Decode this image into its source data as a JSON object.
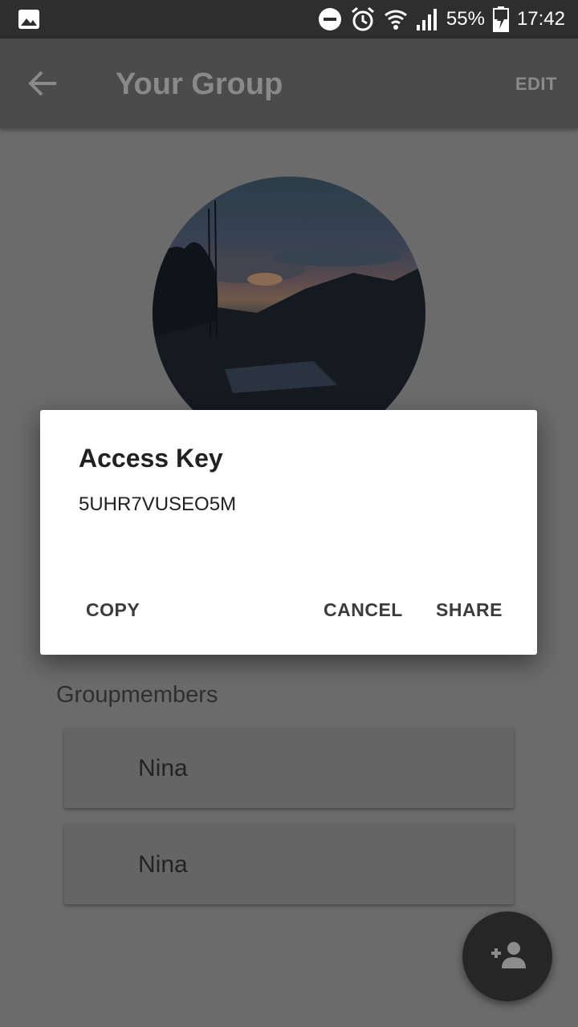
{
  "status_bar": {
    "battery": "55%",
    "time": "17:42",
    "icons": [
      "image-icon",
      "dnd-icon",
      "alarm-icon",
      "wifi-icon",
      "signal-icon",
      "battery-charging-icon"
    ]
  },
  "app_bar": {
    "back_icon": "arrow-left-icon",
    "title": "Your Group",
    "edit_label": "EDIT"
  },
  "group": {
    "photo": "sunset-mountain-photo"
  },
  "members": {
    "heading": "Groupmembers",
    "items": [
      {
        "name": "Nina"
      },
      {
        "name": "Nina"
      }
    ]
  },
  "fab": {
    "icon": "person-add-icon"
  },
  "dialog": {
    "title": "Access Key",
    "key": "5UHR7VUSEO5M",
    "copy_label": "COPY",
    "cancel_label": "CANCEL",
    "share_label": "SHARE"
  },
  "colors": {
    "scrim": "#6b6b6b",
    "app_bar": "#4b4b4b",
    "status_bar": "#2e2e2e",
    "dialog_bg": "#ffffff",
    "fab": "#262626"
  }
}
